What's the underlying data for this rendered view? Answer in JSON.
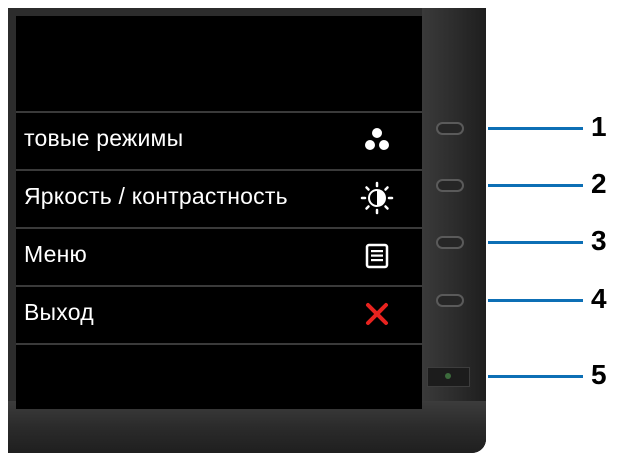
{
  "osd": {
    "items": [
      {
        "label": "товые режимы",
        "icon": "preset-modes-icon"
      },
      {
        "label": "Яркость / контрастность",
        "icon": "brightness-contrast-icon"
      },
      {
        "label": "Меню",
        "icon": "menu-icon"
      },
      {
        "label": "Выход",
        "icon": "exit-icon"
      }
    ]
  },
  "buttons": [
    {
      "number": "1"
    },
    {
      "number": "2"
    },
    {
      "number": "3"
    },
    {
      "number": "4"
    },
    {
      "number": "5"
    }
  ],
  "colors": {
    "callout_line": "#0d6fb5",
    "exit_icon": "#e8231f",
    "screen": "#000000",
    "bezel": "#2c2c2c"
  }
}
